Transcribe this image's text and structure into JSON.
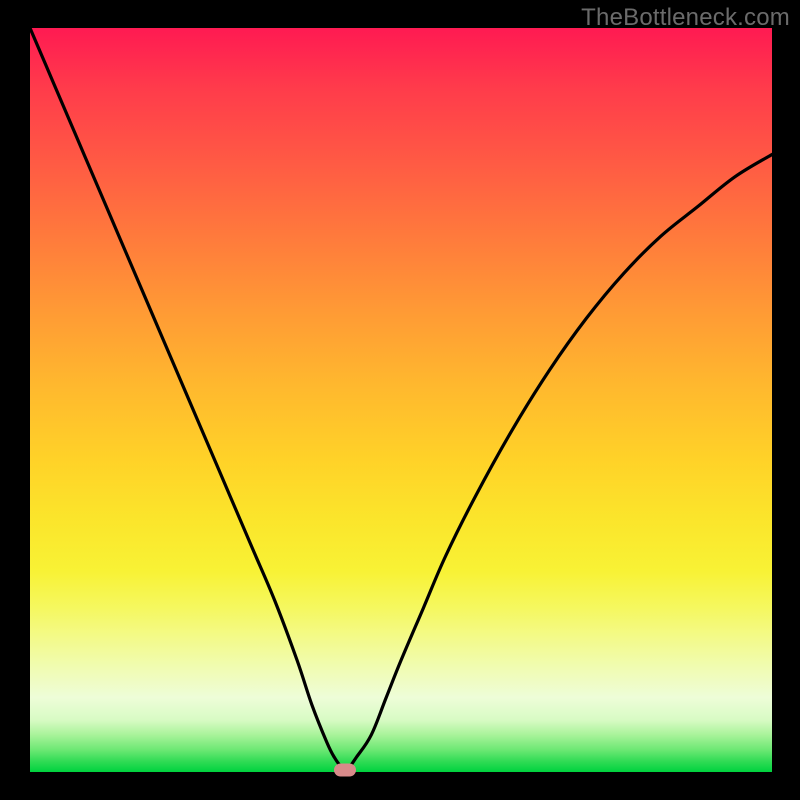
{
  "watermark": "TheBottleneck.com",
  "colors": {
    "curve_stroke": "#000000",
    "marker_fill": "#d88a8a",
    "frame_bg": "#000000"
  },
  "chart_data": {
    "type": "line",
    "title": "",
    "xlabel": "",
    "ylabel": "",
    "xlim": [
      0,
      100
    ],
    "ylim": [
      0,
      100
    ],
    "grid": false,
    "legend": false,
    "series": [
      {
        "name": "bottleneck-curve",
        "x": [
          0,
          3,
          6,
          9,
          12,
          15,
          18,
          21,
          24,
          27,
          30,
          33,
          36,
          38,
          40,
          41,
          42,
          43,
          44,
          46,
          48,
          50,
          53,
          56,
          60,
          65,
          70,
          75,
          80,
          85,
          90,
          95,
          100
        ],
        "y": [
          100,
          93,
          86,
          79,
          72,
          65,
          58,
          51,
          44,
          37,
          30,
          23,
          15,
          9,
          4,
          2,
          0.7,
          0.7,
          2,
          5,
          10,
          15,
          22,
          29,
          37,
          46,
          54,
          61,
          67,
          72,
          76,
          80,
          83
        ]
      }
    ],
    "annotations": [
      {
        "name": "min-marker",
        "x": 42.5,
        "y": 0.3
      }
    ]
  }
}
